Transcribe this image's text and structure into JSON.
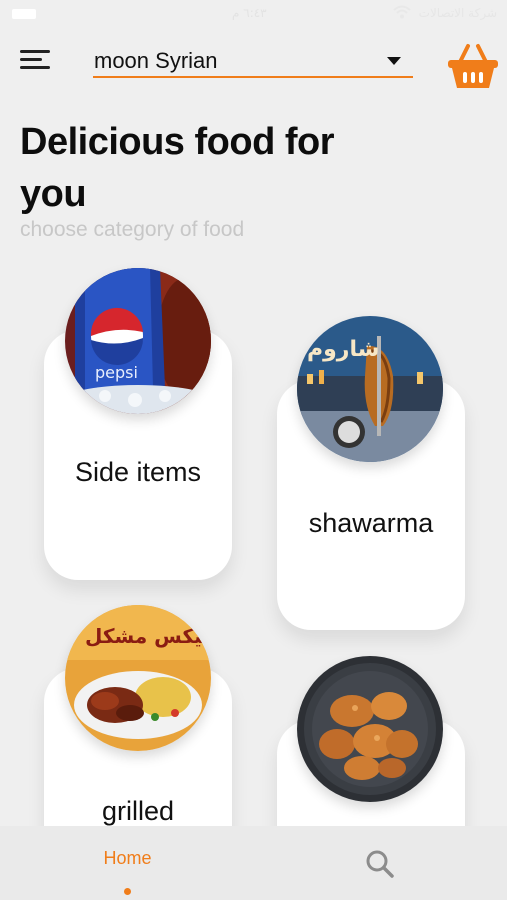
{
  "status_bar": {
    "time": "٦:٤٣ م",
    "carrier": "شركة الاتصالات"
  },
  "header": {
    "menu_icon": "hamburger-menu-icon",
    "store_value": "moon Syrian",
    "store_dropdown_icon": "caret-down-icon",
    "cart_icon": "shopping-basket-icon"
  },
  "main": {
    "title": "Delicious food for you",
    "subtitle": "choose category of food"
  },
  "categories": [
    {
      "label": "Side items",
      "image": "pepsi-can-image"
    },
    {
      "label": "shawarma",
      "image": "shawarma-image"
    },
    {
      "label": "grilled",
      "image": "grilled-meat-plate-image"
    },
    {
      "label": "",
      "image": "fried-chicken-image"
    }
  ],
  "bottom_nav": {
    "home_label": "Home",
    "search_icon": "search-icon"
  },
  "colors": {
    "accent": "#f07d1a",
    "background": "#efefef",
    "card": "#ffffff"
  }
}
